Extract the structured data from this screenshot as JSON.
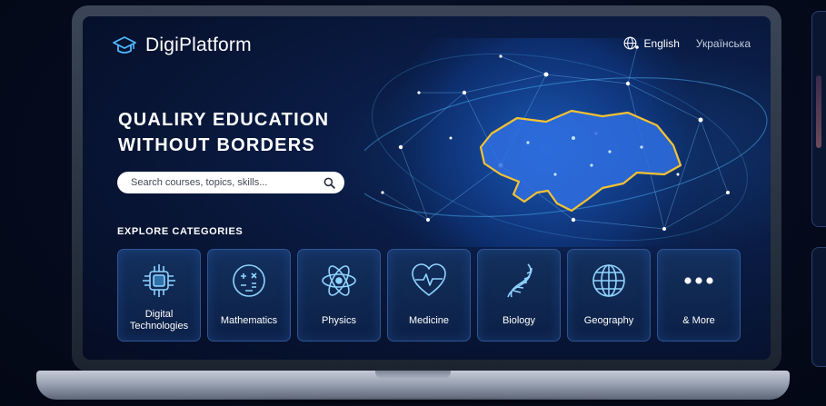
{
  "header": {
    "brand_name": "DigiPlatform",
    "brand_icon": "graduation-cap-icon",
    "languages": [
      "English",
      "Українська"
    ],
    "selected_language": "English"
  },
  "hero": {
    "title_line1": "QUALIRY EDUCATION",
    "title_line2": "WITHOUT BORDERS"
  },
  "search": {
    "placeholder": "Search courses, topics, skills..."
  },
  "categories": {
    "heading": "EXPLORE CATEGORIES",
    "items": [
      {
        "label": "Digital Technologies",
        "icon": "chip-icon"
      },
      {
        "label": "Mathematics",
        "icon": "math-symbols-icon"
      },
      {
        "label": "Physics",
        "icon": "atom-icon"
      },
      {
        "label": "Medicine",
        "icon": "heart-pulse-icon"
      },
      {
        "label": "Biology",
        "icon": "dna-icon"
      },
      {
        "label": "Geography",
        "icon": "globe-icon"
      },
      {
        "label": "& More",
        "icon": "more-dots-icon"
      }
    ]
  },
  "colors": {
    "accent_blue": "#4fb8ff",
    "map_outline": "#f5c232",
    "map_fill": "#2f6fe0",
    "background": "#071331"
  }
}
